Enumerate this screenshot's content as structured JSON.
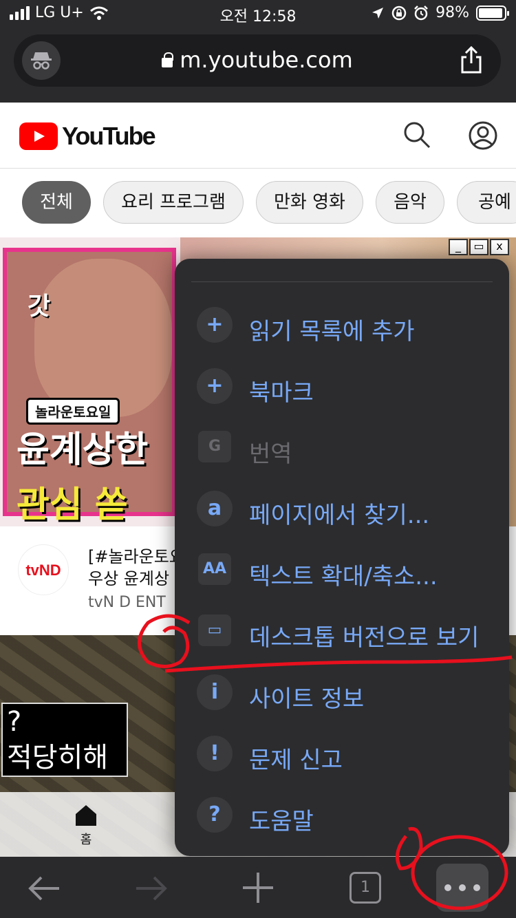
{
  "status": {
    "carrier": "LG U+",
    "time": "오전 12:58",
    "battery": "98%"
  },
  "urlbar": {
    "url": "m.youtube.com"
  },
  "youtube": {
    "logo_text": "YouTube",
    "chips": [
      "전체",
      "요리 프로그램",
      "만화 영화",
      "음악",
      "공예"
    ]
  },
  "video1": {
    "thumb_badge": "놀라운토요일",
    "thumb_line1": "윤계상한",
    "thumb_line2": "관심 쏟",
    "thumb_logo": "갓",
    "window_buttons": [
      "_",
      "▭",
      "x"
    ],
    "avatar_text": "tvND",
    "title_line1": "[#놀라운토요",
    "title_line2": "우상 윤계상",
    "channel": "tvN D ENT"
  },
  "video2": {
    "box_line1": "?",
    "box_line2": "적당히해"
  },
  "bottom_nav": {
    "home_label": "홈"
  },
  "menu": {
    "items": [
      {
        "label": "읽기 목록에 추가",
        "icon": "reading-list-add-icon",
        "glyph": "+"
      },
      {
        "label": "북마크",
        "icon": "bookmark-star-icon",
        "glyph": "+"
      },
      {
        "label": "번역",
        "icon": "translate-icon",
        "glyph": "G"
      },
      {
        "label": "페이지에서 찾기...",
        "icon": "find-in-page-icon",
        "glyph": "a"
      },
      {
        "label": "텍스트 확대/축소...",
        "icon": "text-zoom-icon",
        "glyph": "AA"
      },
      {
        "label": "데스크톱 버전으로 보기",
        "icon": "desktop-site-icon",
        "glyph": "▭"
      },
      {
        "label": "사이트 정보",
        "icon": "site-info-icon",
        "glyph": "i"
      },
      {
        "label": "문제 신고",
        "icon": "report-issue-icon",
        "glyph": "!"
      },
      {
        "label": "도움말",
        "icon": "help-icon",
        "glyph": "?"
      }
    ]
  },
  "toolbar": {
    "tab_count": "1"
  },
  "annotations": {
    "mark1": "①",
    "mark2": "②"
  },
  "colors": {
    "menu_text": "#78a9f7",
    "menu_bg": "#2c2c2e",
    "yt_red": "#ff0000",
    "annotation_red": "#e8101d"
  }
}
